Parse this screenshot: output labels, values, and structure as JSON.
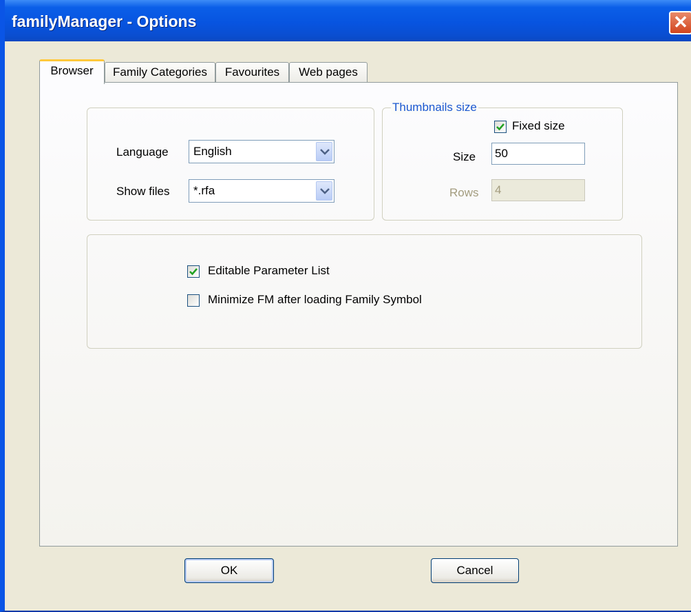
{
  "window": {
    "title": "familyManager - Options"
  },
  "tabs": [
    {
      "label": "Browser",
      "active": true
    },
    {
      "label": "Family Categories",
      "active": false
    },
    {
      "label": "Favourites",
      "active": false
    },
    {
      "label": "Web pages",
      "active": false
    }
  ],
  "browser": {
    "language_label": "Language",
    "language_value": "English",
    "show_files_label": "Show files",
    "show_files_value": "*.rfa",
    "thumbnails": {
      "group_title": "Thumbnails size",
      "fixed_size_label": "Fixed size",
      "fixed_size_checked": true,
      "size_label": "Size",
      "size_value": "50",
      "rows_label": "Rows",
      "rows_value": "4",
      "rows_enabled": false
    },
    "options": {
      "editable_param_label": "Editable Parameter List",
      "editable_param_checked": true,
      "minimize_fm_label": "Minimize FM after loading Family Symbol",
      "minimize_fm_checked": false
    }
  },
  "buttons": {
    "ok": "OK",
    "cancel": "Cancel"
  },
  "colors": {
    "titlebar": "#0754e0",
    "face": "#ece9d8",
    "group_title": "#1b58d0",
    "active_tab_accent": "#ffc83c"
  }
}
